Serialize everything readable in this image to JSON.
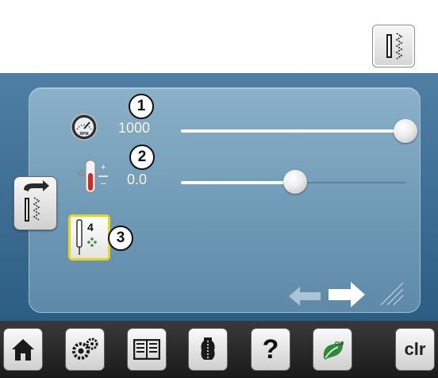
{
  "top_icon": {
    "name": "stitch-width-icon"
  },
  "screen": {
    "settings": [
      {
        "callout": "1",
        "value": "1000",
        "level": 1.0,
        "icon": "sewing-speed-icon"
      },
      {
        "callout": "2",
        "value": "0.0",
        "level": 0.5,
        "icon": "thread-tension-icon"
      },
      {
        "callout": "3",
        "icon": "needle-stop-icon",
        "needle_label": "4"
      }
    ],
    "back_button_icon": "back-to-stitch-icon",
    "nav": {
      "left_arrow_enabled": false,
      "right_arrow_enabled": true
    }
  },
  "bottom_bar": {
    "buttons": [
      "home-icon",
      "setup-gears-icon",
      "tutorial-book-icon",
      "sewing-consultant-icon",
      "help-icon",
      "eco-icon",
      "clr"
    ],
    "help_label": "?",
    "clr_label": "clr"
  },
  "colors": {
    "screen_bg": "#3d6d93",
    "panel_bg": "#7ba4bf",
    "highlight_border": "#e7d61a"
  }
}
